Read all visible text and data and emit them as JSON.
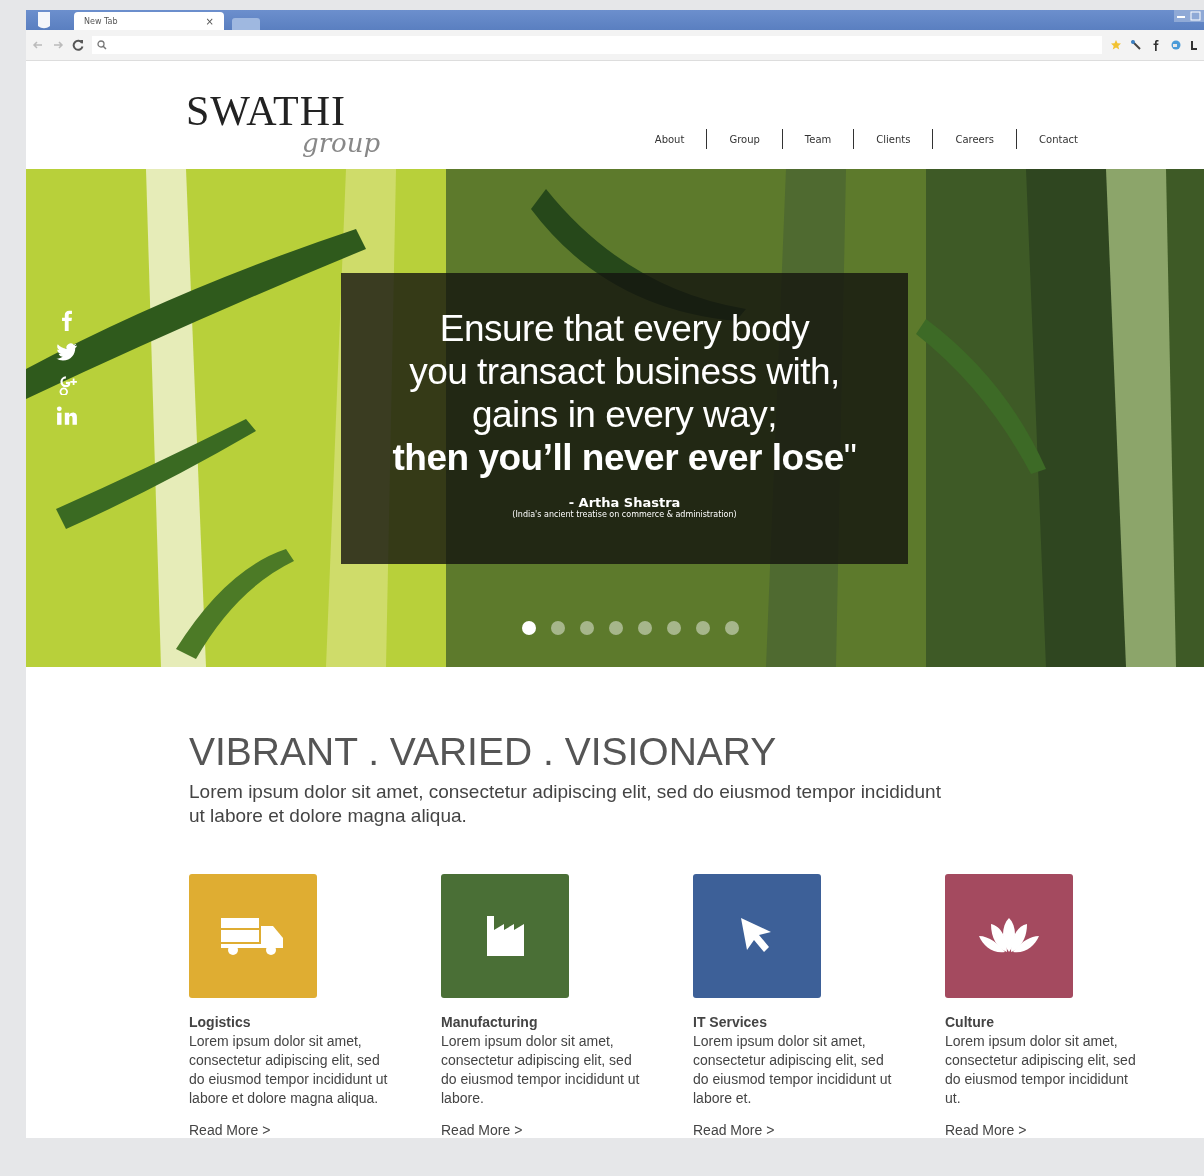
{
  "browser": {
    "tab_title": "New Tab",
    "tab_close": "×"
  },
  "header": {
    "logo_main": "SWATHI",
    "logo_sub": "group",
    "nav": [
      {
        "label": "About"
      },
      {
        "label": "Group"
      },
      {
        "label": "Team"
      },
      {
        "label": "Clients"
      },
      {
        "label": "Careers"
      },
      {
        "label": "Contact"
      }
    ]
  },
  "hero": {
    "kind": "picture",
    "quote": "Ensure that every body\nyou transact business with,\ngains in every way;\n**then you’ll never ever lose**\"",
    "author": "- Artha Shastra",
    "source": "(India's ancient treatise on commerce & administration)",
    "social": [
      {
        "kind": "facebook"
      },
      {
        "kind": "twitter"
      },
      {
        "kind": "googleplus"
      },
      {
        "kind": "linkedin"
      }
    ],
    "dots": [
      {
        "selected": true
      },
      {
        "selected": false
      },
      {
        "selected": false
      },
      {
        "selected": false
      },
      {
        "selected": false
      },
      {
        "selected": false
      },
      {
        "selected": false
      },
      {
        "selected": false
      }
    ]
  },
  "intro": {
    "heading": "VIBRANT . VARIED . VISIONARY",
    "text": "Lorem ipsum dolor sit amet, consectetur adipiscing elit, sed do eiusmod tempor incididunt ut labore et dolore magna aliqua."
  },
  "cards": [
    {
      "kind": "truck",
      "color": "#dfad32",
      "title": "Logistics",
      "text": "Lorem ipsum dolor sit amet, consectetur adipiscing elit, sed do eiusmod tempor incididunt ut labore et dolore magna aliqua.",
      "link": "Read More >"
    },
    {
      "kind": "factory",
      "color": "#4a6f36",
      "title": "Manufacturing",
      "text": "Lorem ipsum dolor sit amet, consectetur adipiscing elit, sed do eiusmod tempor incididunt ut labore.",
      "link": "Read More >"
    },
    {
      "kind": "cursor",
      "color": "#3d6098",
      "title": "IT Services",
      "text": "Lorem ipsum dolor sit amet, consectetur adipiscing elit, sed do eiusmod tempor incididunt ut labore et.",
      "link": "Read More >"
    },
    {
      "kind": "lotus",
      "color": "#a44a5f",
      "title": "Culture",
      "text": "Lorem ipsum dolor sit amet, consectetur adipiscing elit, sed do eiusmod tempor incididunt ut.",
      "link": "Read More >"
    }
  ]
}
